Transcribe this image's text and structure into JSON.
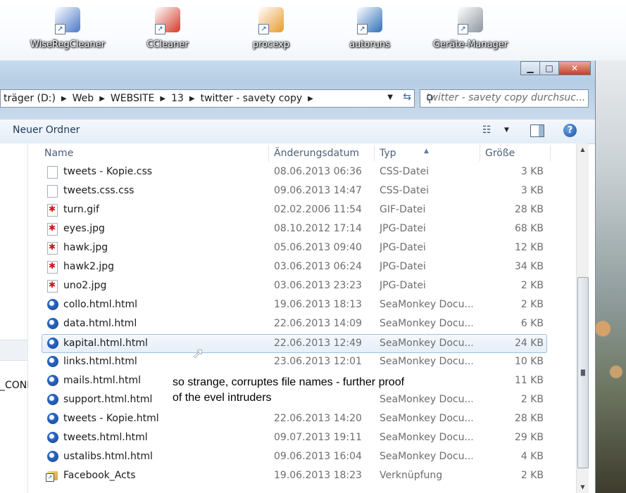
{
  "desktop": {
    "icons": [
      {
        "label": "WiseRegCleaner",
        "icon": "wiseregcleaner-icon",
        "color": "#4a78c8"
      },
      {
        "label": "CCleaner",
        "icon": "ccleaner-icon",
        "color": "#d33a2a"
      },
      {
        "label": "procexp",
        "icon": "procexp-icon",
        "color": "#e79b2d"
      },
      {
        "label": "autoruns",
        "icon": "autoruns-icon",
        "color": "#2f6fb8"
      },
      {
        "label": "Geräte-Manager",
        "icon": "device-manager-icon",
        "color": "#8c959e"
      }
    ]
  },
  "window": {
    "buttons": {
      "minimize": "▁",
      "maximize": "□",
      "close": "✕"
    }
  },
  "address": {
    "crumbs": [
      "träger (D:)",
      "Web",
      "WEBSITE",
      "13",
      "twitter - savety copy"
    ],
    "search_placeholder": "twitter - savety copy durchsuc..."
  },
  "toolbar": {
    "new_folder": "Neuer Ordner",
    "help": "?"
  },
  "navpane": {
    "partial_text": "_CONI"
  },
  "columns": {
    "name": "Name",
    "date": "Änderungsdatum",
    "type": "Typ",
    "size": "Größe"
  },
  "files": [
    {
      "name": "tweets - Kopie.css",
      "date": "08.06.2013 06:36",
      "type": "CSS-Datei",
      "size": "3 KB",
      "icon": "css"
    },
    {
      "name": "tweets.css.css",
      "date": "09.06.2013 14:47",
      "type": "CSS-Datei",
      "size": "3 KB",
      "icon": "css"
    },
    {
      "name": "turn.gif",
      "date": "02.02.2006 11:54",
      "type": "GIF-Datei",
      "size": "28 KB",
      "icon": "img"
    },
    {
      "name": "eyes.jpg",
      "date": "08.10.2012 17:14",
      "type": "JPG-Datei",
      "size": "68 KB",
      "icon": "img"
    },
    {
      "name": "hawk.jpg",
      "date": "05.06.2013 09:40",
      "type": "JPG-Datei",
      "size": "12 KB",
      "icon": "img"
    },
    {
      "name": "hawk2.jpg",
      "date": "03.06.2013 06:24",
      "type": "JPG-Datei",
      "size": "34 KB",
      "icon": "img"
    },
    {
      "name": "uno2.jpg",
      "date": "03.06.2013 23:23",
      "type": "JPG-Datei",
      "size": "2 KB",
      "icon": "img"
    },
    {
      "name": "collo.html.html",
      "date": "19.06.2013 18:13",
      "type": "SeaMonkey Docu...",
      "size": "2 KB",
      "icon": "html"
    },
    {
      "name": "data.html.html",
      "date": "22.06.2013 14:09",
      "type": "SeaMonkey Docu...",
      "size": "6 KB",
      "icon": "html"
    },
    {
      "name": "kapital.html.html",
      "date": "22.06.2013 12:49",
      "type": "SeaMonkey Docu...",
      "size": "24 KB",
      "icon": "html",
      "selected": true
    },
    {
      "name": "links.html.html",
      "date": "23.06.2013 12:01",
      "type": "SeaMonkey Docu...",
      "size": "10 KB",
      "icon": "html"
    },
    {
      "name": "mails.html.html",
      "date": "",
      "type": "",
      "size": "11 KB",
      "icon": "html"
    },
    {
      "name": "support.html.html",
      "date": "",
      "type": "SeaMonkey Docu...",
      "size": "2 KB",
      "icon": "html"
    },
    {
      "name": "tweets - Kopie.html",
      "date": "22.06.2013 14:20",
      "type": "SeaMonkey Docu...",
      "size": "28 KB",
      "icon": "html"
    },
    {
      "name": "tweets.html.html",
      "date": "09.07.2013 19:11",
      "type": "SeaMonkey Docu...",
      "size": "29 KB",
      "icon": "html"
    },
    {
      "name": "ustalibs.html.html",
      "date": "09.06.2013 16:04",
      "type": "SeaMonkey Docu...",
      "size": "4 KB",
      "icon": "html"
    },
    {
      "name": "Facebook_Acts",
      "date": "19.06.2013 18:23",
      "type": "Verknüpfung",
      "size": "2 KB",
      "icon": "lnk"
    }
  ],
  "annotation": {
    "line1": "so strange, corruptes file names - further proof",
    "line2": "of the evel intruders"
  }
}
